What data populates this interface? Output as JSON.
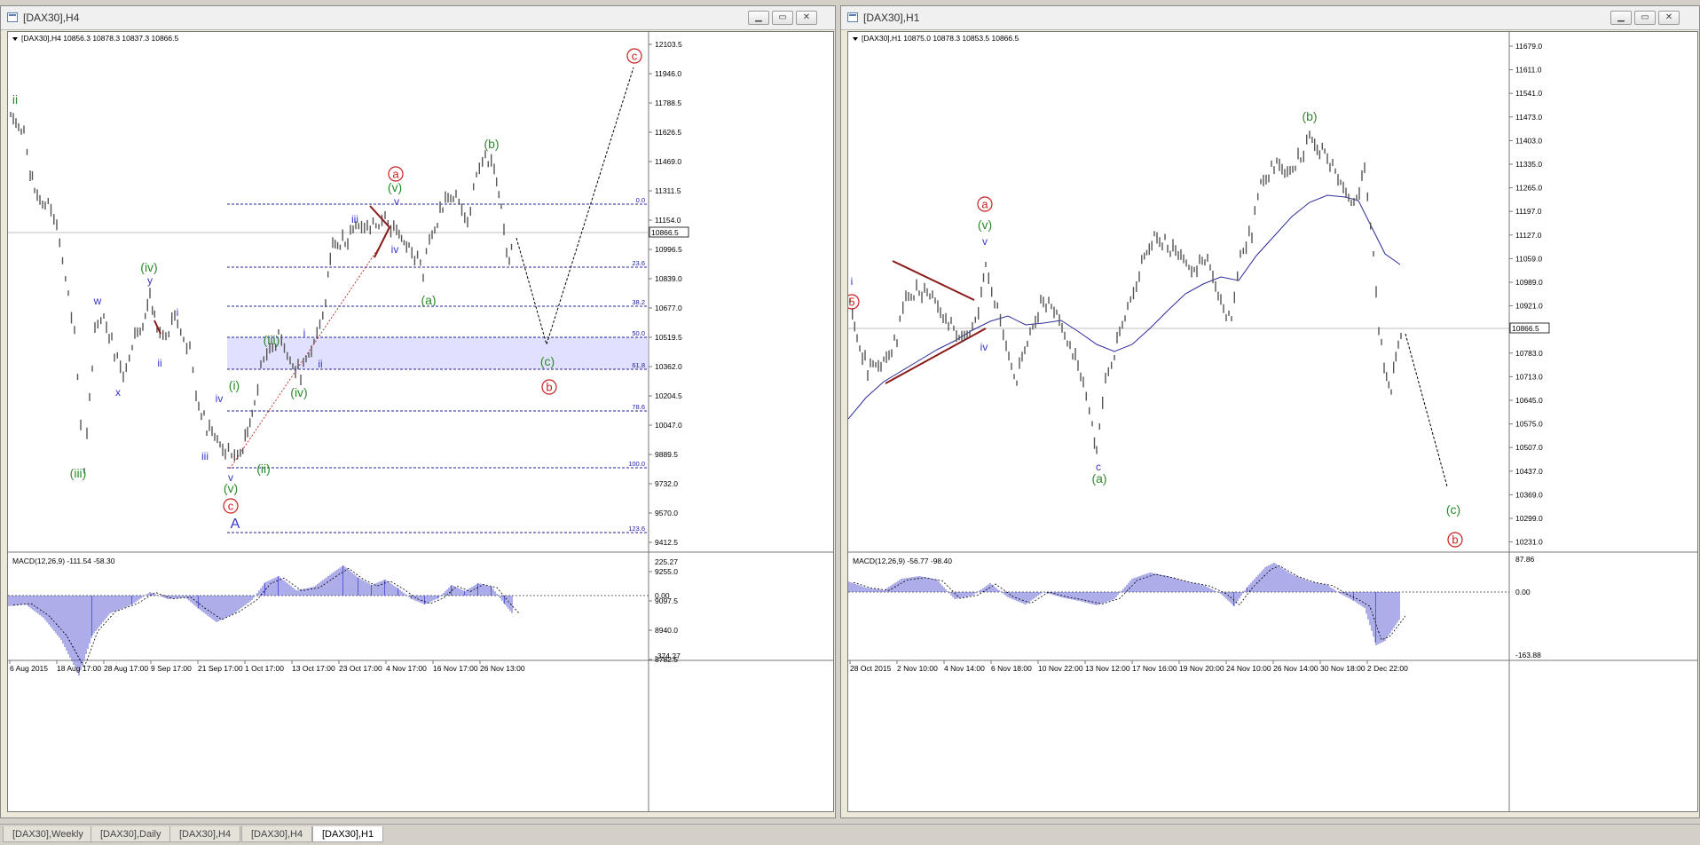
{
  "windows": {
    "left": {
      "title": "[DAX30],H4",
      "header": "[DAX30],H4  10856.3 10878.3 10837.3 10866.5",
      "price_axis": [
        "12103.5",
        "11946.0",
        "11788.5",
        "11626.5",
        "11469.0",
        "11311.5",
        "11154.0",
        "10996.5",
        "10839.0",
        "10677.0",
        "10519.5",
        "10362.0",
        "10204.5",
        "10047.0",
        "9889.5",
        "9732.0",
        "9570.0",
        "9412.5",
        "9255.0",
        "9097.5",
        "8940.0",
        "8782.5"
      ],
      "current_price": "10866.5",
      "fib_labels": [
        "0.0",
        "23.6",
        "38.2",
        "50.0",
        "61.8",
        "78.6",
        "100.0",
        "123.6"
      ],
      "macd_label": "MACD(12,26,9) -111.54 -58.30",
      "macd_axis": [
        "225.27",
        "0.00",
        "-374.27"
      ],
      "time_axis": [
        "6 Aug 2015",
        "18 Aug 17:00",
        "28 Aug 17:00",
        "9 Sep 17:00",
        "21 Sep 17:00",
        "1 Oct 17:00",
        "13 Oct 17:00",
        "23 Oct 17:00",
        "4 Nov 17:00",
        "16 Nov 17:00",
        "26 Nov 13:00"
      ],
      "wave_labels": {
        "ii_top": "ii",
        "iii_p": "(iii)",
        "iv_p": "(iv)",
        "w": "w",
        "x": "x",
        "y": "y",
        "i1": "i",
        "ii1": "ii",
        "iv1": "iv",
        "iii1": "iii",
        "i_p": "(i)",
        "v": "v",
        "v_p": "(v)",
        "c_circle": "c",
        "A": "A",
        "ii_p": "(ii)",
        "iii_p2": "(iii)",
        "i2": "i",
        "ii2": "ii",
        "iv_p2": "(iv)",
        "iii2": "iii",
        "iv2": "iv",
        "v2": "v",
        "v_p2": "(v)",
        "a_circle": "a",
        "a_p": "(a)",
        "b_p": "(b)",
        "c_p": "(c)",
        "b_circle": "b",
        "c_circle_top": "c"
      }
    },
    "right": {
      "title": "[DAX30],H1",
      "header": "[DAX30],H1  10875.0 10878.3 10853.5 10866.5",
      "price_axis": [
        "11679.0",
        "11611.0",
        "11541.0",
        "11473.0",
        "11403.0",
        "11335.0",
        "11265.0",
        "11197.0",
        "11127.0",
        "11059.0",
        "10989.0",
        "10921.0",
        "10851.0",
        "10783.0",
        "10713.0",
        "10645.0",
        "10575.0",
        "10507.0",
        "10437.0",
        "10369.0",
        "10299.0",
        "10231.0"
      ],
      "current_price": "10866.5",
      "macd_label": "MACD(12,26,9) -56.77 -98.40",
      "macd_axis": [
        "87.86",
        "0.00",
        "-163.88"
      ],
      "time_axis": [
        "28 Oct 2015",
        "2 Nov 10:00",
        "4 Nov 14:00",
        "6 Nov 18:00",
        "10 Nov 22:00",
        "13 Nov 12:00",
        "17 Nov 16:00",
        "19 Nov 20:00",
        "24 Nov 10:00",
        "26 Nov 14:00",
        "30 Nov 18:00",
        "2 Dec 22:00"
      ],
      "wave_labels": {
        "i": "i",
        "five": "5",
        "a_circle": "a",
        "v_p": "(v)",
        "v": "v",
        "iv": "iv",
        "c": "c",
        "a_p": "(a)",
        "b_p": "(b)",
        "c_p": "(c)",
        "b_circle": "b"
      }
    }
  },
  "tabs": [
    "[DAX30],Weekly",
    "[DAX30],Daily",
    "[DAX30],H4",
    "[DAX30],H4",
    "[DAX30],H1"
  ],
  "active_tab": "[DAX30],H1",
  "colors": {
    "wave_green": "#2a8a2a",
    "wave_blue": "#3535c8",
    "wave_red": "#c81e1e",
    "fib_line": "#2020a0",
    "fib_zone": "#c8c8ff",
    "ma_line": "#2b2b9a",
    "macd_bar": "#5b5bd6",
    "trend_line": "#8b1a1a"
  }
}
